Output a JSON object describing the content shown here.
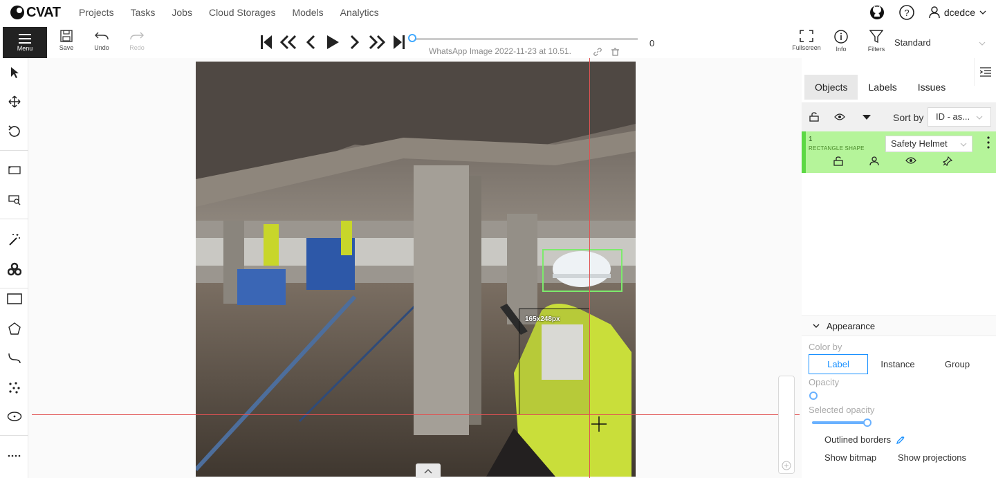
{
  "app": {
    "name": "CVAT"
  },
  "nav": {
    "links": [
      "Projects",
      "Tasks",
      "Jobs",
      "Cloud Storages",
      "Models",
      "Analytics"
    ],
    "username": "dcedce"
  },
  "toolbar": {
    "menu_label": "Menu",
    "save_label": "Save",
    "undo_label": "Undo",
    "redo_label": "Redo",
    "filename": "WhatsApp Image 2022-11-23 at 10.51.",
    "frame_number": "0",
    "fullscreen_label": "Fullscreen",
    "info_label": "Info",
    "filters_label": "Filters",
    "workspace": "Standard"
  },
  "canvas": {
    "bbox_size_label": "165x248px"
  },
  "sidebar": {
    "tabs": [
      "Objects",
      "Labels",
      "Issues"
    ],
    "sort_label": "Sort by",
    "sort_value": "ID - as...",
    "objects": [
      {
        "id": "1",
        "type": "RECTANGLE SHAPE",
        "label": "Safety Helmet",
        "color": "#b5f49a"
      }
    ]
  },
  "appearance": {
    "title": "Appearance",
    "color_by_label": "Color by",
    "color_by_options": [
      "Label",
      "Instance",
      "Group"
    ],
    "color_by_selected": "Label",
    "opacity_label": "Opacity",
    "opacity_value": 0.0,
    "selected_opacity_label": "Selected opacity",
    "selected_opacity_value": 0.97,
    "outlined_borders_label": "Outlined borders",
    "show_bitmap_label": "Show bitmap",
    "show_projections_label": "Show projections"
  },
  "colors": {
    "accent": "#1890ff",
    "crosshair": "#e05252",
    "object": "#7dea6c"
  }
}
